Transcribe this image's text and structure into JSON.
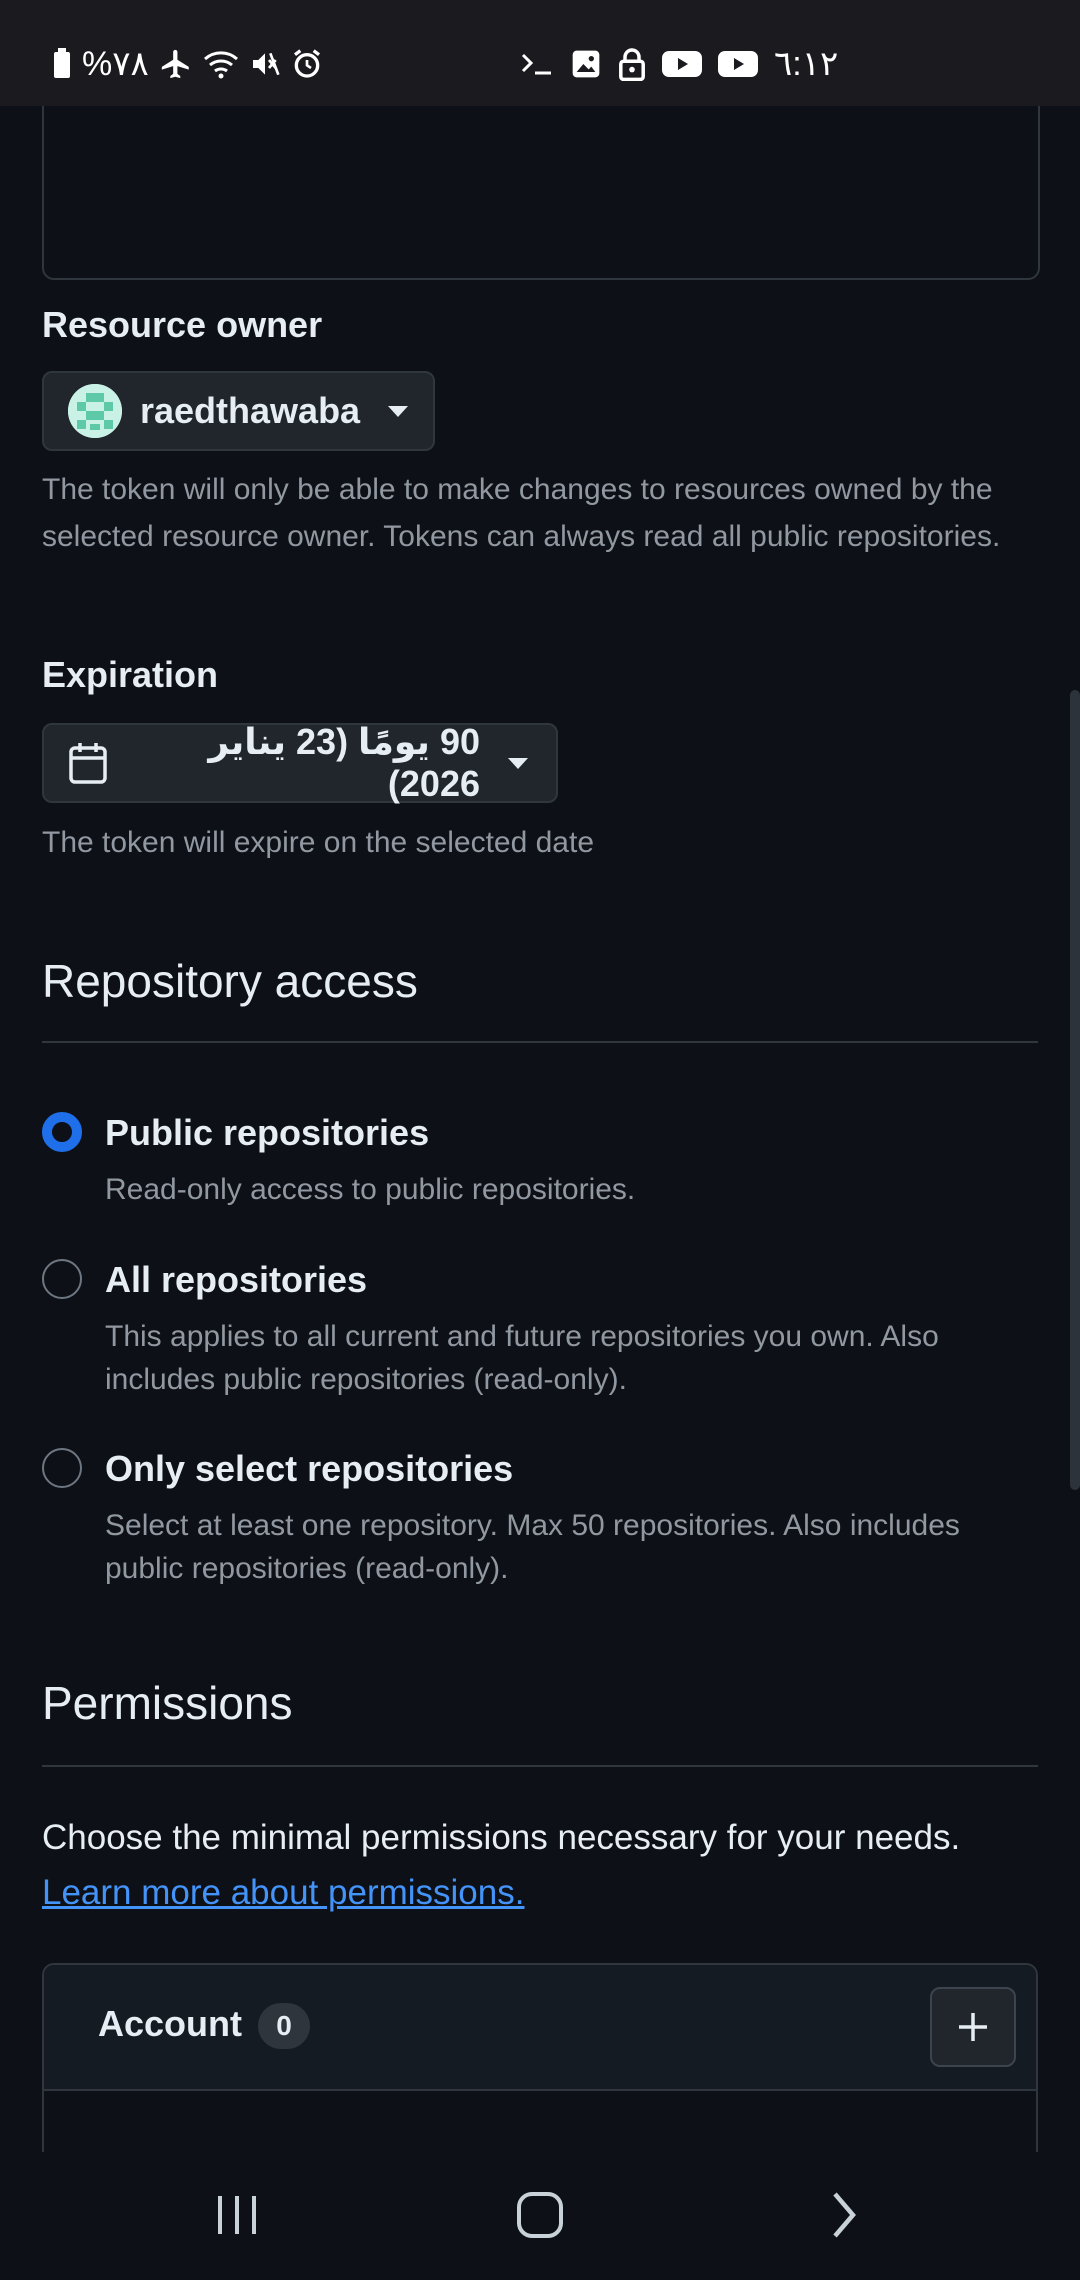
{
  "status_bar": {
    "battery_percent": "%٧٨",
    "time": "٦:١٢",
    "icons": [
      "battery-icon",
      "airplane-icon",
      "wifi-icon",
      "mute-icon",
      "alarm-icon",
      "terminal-icon",
      "gallery-icon",
      "lock-icon",
      "youtube-icon",
      "youtube-icon"
    ]
  },
  "resource_owner": {
    "label": "Resource owner",
    "selected": "raedthawaba",
    "help": "The token will only be able to make changes to resources owned by the selected resource owner. Tokens can always read all public repositories."
  },
  "expiration": {
    "label": "Expiration",
    "selected": "90 يومًا (23 يناير 2026)",
    "help": "The token will expire on the selected date"
  },
  "repository_access": {
    "title": "Repository access",
    "options": [
      {
        "title": "Public repositories",
        "description": "Read-only access to public repositories.",
        "checked": true
      },
      {
        "title": "All repositories",
        "description": "This applies to all current and future repositories you own. Also includes public repositories (read-only).",
        "checked": false
      },
      {
        "title": "Only select repositories",
        "description": "Select at least one repository. Max 50 repositories. Also includes public repositories (read-only).",
        "checked": false
      }
    ]
  },
  "permissions": {
    "title": "Permissions",
    "intro": "Choose the minimal permissions necessary for your needs.",
    "link": "Learn more about permissions.",
    "account": {
      "title": "Account",
      "count": "0"
    }
  },
  "colors": {
    "background": "#0d1117",
    "accent": "#1f6feb",
    "link": "#4493f8"
  }
}
